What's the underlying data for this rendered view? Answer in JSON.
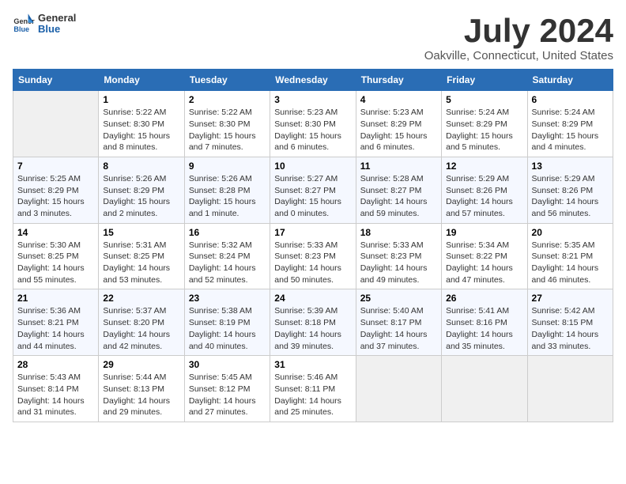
{
  "header": {
    "logo_general": "General",
    "logo_blue": "Blue",
    "month_title": "July 2024",
    "location": "Oakville, Connecticut, United States"
  },
  "weekdays": [
    "Sunday",
    "Monday",
    "Tuesday",
    "Wednesday",
    "Thursday",
    "Friday",
    "Saturday"
  ],
  "weeks": [
    [
      {
        "day": "",
        "info": ""
      },
      {
        "day": "1",
        "info": "Sunrise: 5:22 AM\nSunset: 8:30 PM\nDaylight: 15 hours\nand 8 minutes."
      },
      {
        "day": "2",
        "info": "Sunrise: 5:22 AM\nSunset: 8:30 PM\nDaylight: 15 hours\nand 7 minutes."
      },
      {
        "day": "3",
        "info": "Sunrise: 5:23 AM\nSunset: 8:30 PM\nDaylight: 15 hours\nand 6 minutes."
      },
      {
        "day": "4",
        "info": "Sunrise: 5:23 AM\nSunset: 8:29 PM\nDaylight: 15 hours\nand 6 minutes."
      },
      {
        "day": "5",
        "info": "Sunrise: 5:24 AM\nSunset: 8:29 PM\nDaylight: 15 hours\nand 5 minutes."
      },
      {
        "day": "6",
        "info": "Sunrise: 5:24 AM\nSunset: 8:29 PM\nDaylight: 15 hours\nand 4 minutes."
      }
    ],
    [
      {
        "day": "7",
        "info": "Sunrise: 5:25 AM\nSunset: 8:29 PM\nDaylight: 15 hours\nand 3 minutes."
      },
      {
        "day": "8",
        "info": "Sunrise: 5:26 AM\nSunset: 8:29 PM\nDaylight: 15 hours\nand 2 minutes."
      },
      {
        "day": "9",
        "info": "Sunrise: 5:26 AM\nSunset: 8:28 PM\nDaylight: 15 hours\nand 1 minute."
      },
      {
        "day": "10",
        "info": "Sunrise: 5:27 AM\nSunset: 8:27 PM\nDaylight: 15 hours\nand 0 minutes."
      },
      {
        "day": "11",
        "info": "Sunrise: 5:28 AM\nSunset: 8:27 PM\nDaylight: 14 hours\nand 59 minutes."
      },
      {
        "day": "12",
        "info": "Sunrise: 5:29 AM\nSunset: 8:26 PM\nDaylight: 14 hours\nand 57 minutes."
      },
      {
        "day": "13",
        "info": "Sunrise: 5:29 AM\nSunset: 8:26 PM\nDaylight: 14 hours\nand 56 minutes."
      }
    ],
    [
      {
        "day": "14",
        "info": "Sunrise: 5:30 AM\nSunset: 8:25 PM\nDaylight: 14 hours\nand 55 minutes."
      },
      {
        "day": "15",
        "info": "Sunrise: 5:31 AM\nSunset: 8:25 PM\nDaylight: 14 hours\nand 53 minutes."
      },
      {
        "day": "16",
        "info": "Sunrise: 5:32 AM\nSunset: 8:24 PM\nDaylight: 14 hours\nand 52 minutes."
      },
      {
        "day": "17",
        "info": "Sunrise: 5:33 AM\nSunset: 8:23 PM\nDaylight: 14 hours\nand 50 minutes."
      },
      {
        "day": "18",
        "info": "Sunrise: 5:33 AM\nSunset: 8:23 PM\nDaylight: 14 hours\nand 49 minutes."
      },
      {
        "day": "19",
        "info": "Sunrise: 5:34 AM\nSunset: 8:22 PM\nDaylight: 14 hours\nand 47 minutes."
      },
      {
        "day": "20",
        "info": "Sunrise: 5:35 AM\nSunset: 8:21 PM\nDaylight: 14 hours\nand 46 minutes."
      }
    ],
    [
      {
        "day": "21",
        "info": "Sunrise: 5:36 AM\nSunset: 8:21 PM\nDaylight: 14 hours\nand 44 minutes."
      },
      {
        "day": "22",
        "info": "Sunrise: 5:37 AM\nSunset: 8:20 PM\nDaylight: 14 hours\nand 42 minutes."
      },
      {
        "day": "23",
        "info": "Sunrise: 5:38 AM\nSunset: 8:19 PM\nDaylight: 14 hours\nand 40 minutes."
      },
      {
        "day": "24",
        "info": "Sunrise: 5:39 AM\nSunset: 8:18 PM\nDaylight: 14 hours\nand 39 minutes."
      },
      {
        "day": "25",
        "info": "Sunrise: 5:40 AM\nSunset: 8:17 PM\nDaylight: 14 hours\nand 37 minutes."
      },
      {
        "day": "26",
        "info": "Sunrise: 5:41 AM\nSunset: 8:16 PM\nDaylight: 14 hours\nand 35 minutes."
      },
      {
        "day": "27",
        "info": "Sunrise: 5:42 AM\nSunset: 8:15 PM\nDaylight: 14 hours\nand 33 minutes."
      }
    ],
    [
      {
        "day": "28",
        "info": "Sunrise: 5:43 AM\nSunset: 8:14 PM\nDaylight: 14 hours\nand 31 minutes."
      },
      {
        "day": "29",
        "info": "Sunrise: 5:44 AM\nSunset: 8:13 PM\nDaylight: 14 hours\nand 29 minutes."
      },
      {
        "day": "30",
        "info": "Sunrise: 5:45 AM\nSunset: 8:12 PM\nDaylight: 14 hours\nand 27 minutes."
      },
      {
        "day": "31",
        "info": "Sunrise: 5:46 AM\nSunset: 8:11 PM\nDaylight: 14 hours\nand 25 minutes."
      },
      {
        "day": "",
        "info": ""
      },
      {
        "day": "",
        "info": ""
      },
      {
        "day": "",
        "info": ""
      }
    ]
  ]
}
